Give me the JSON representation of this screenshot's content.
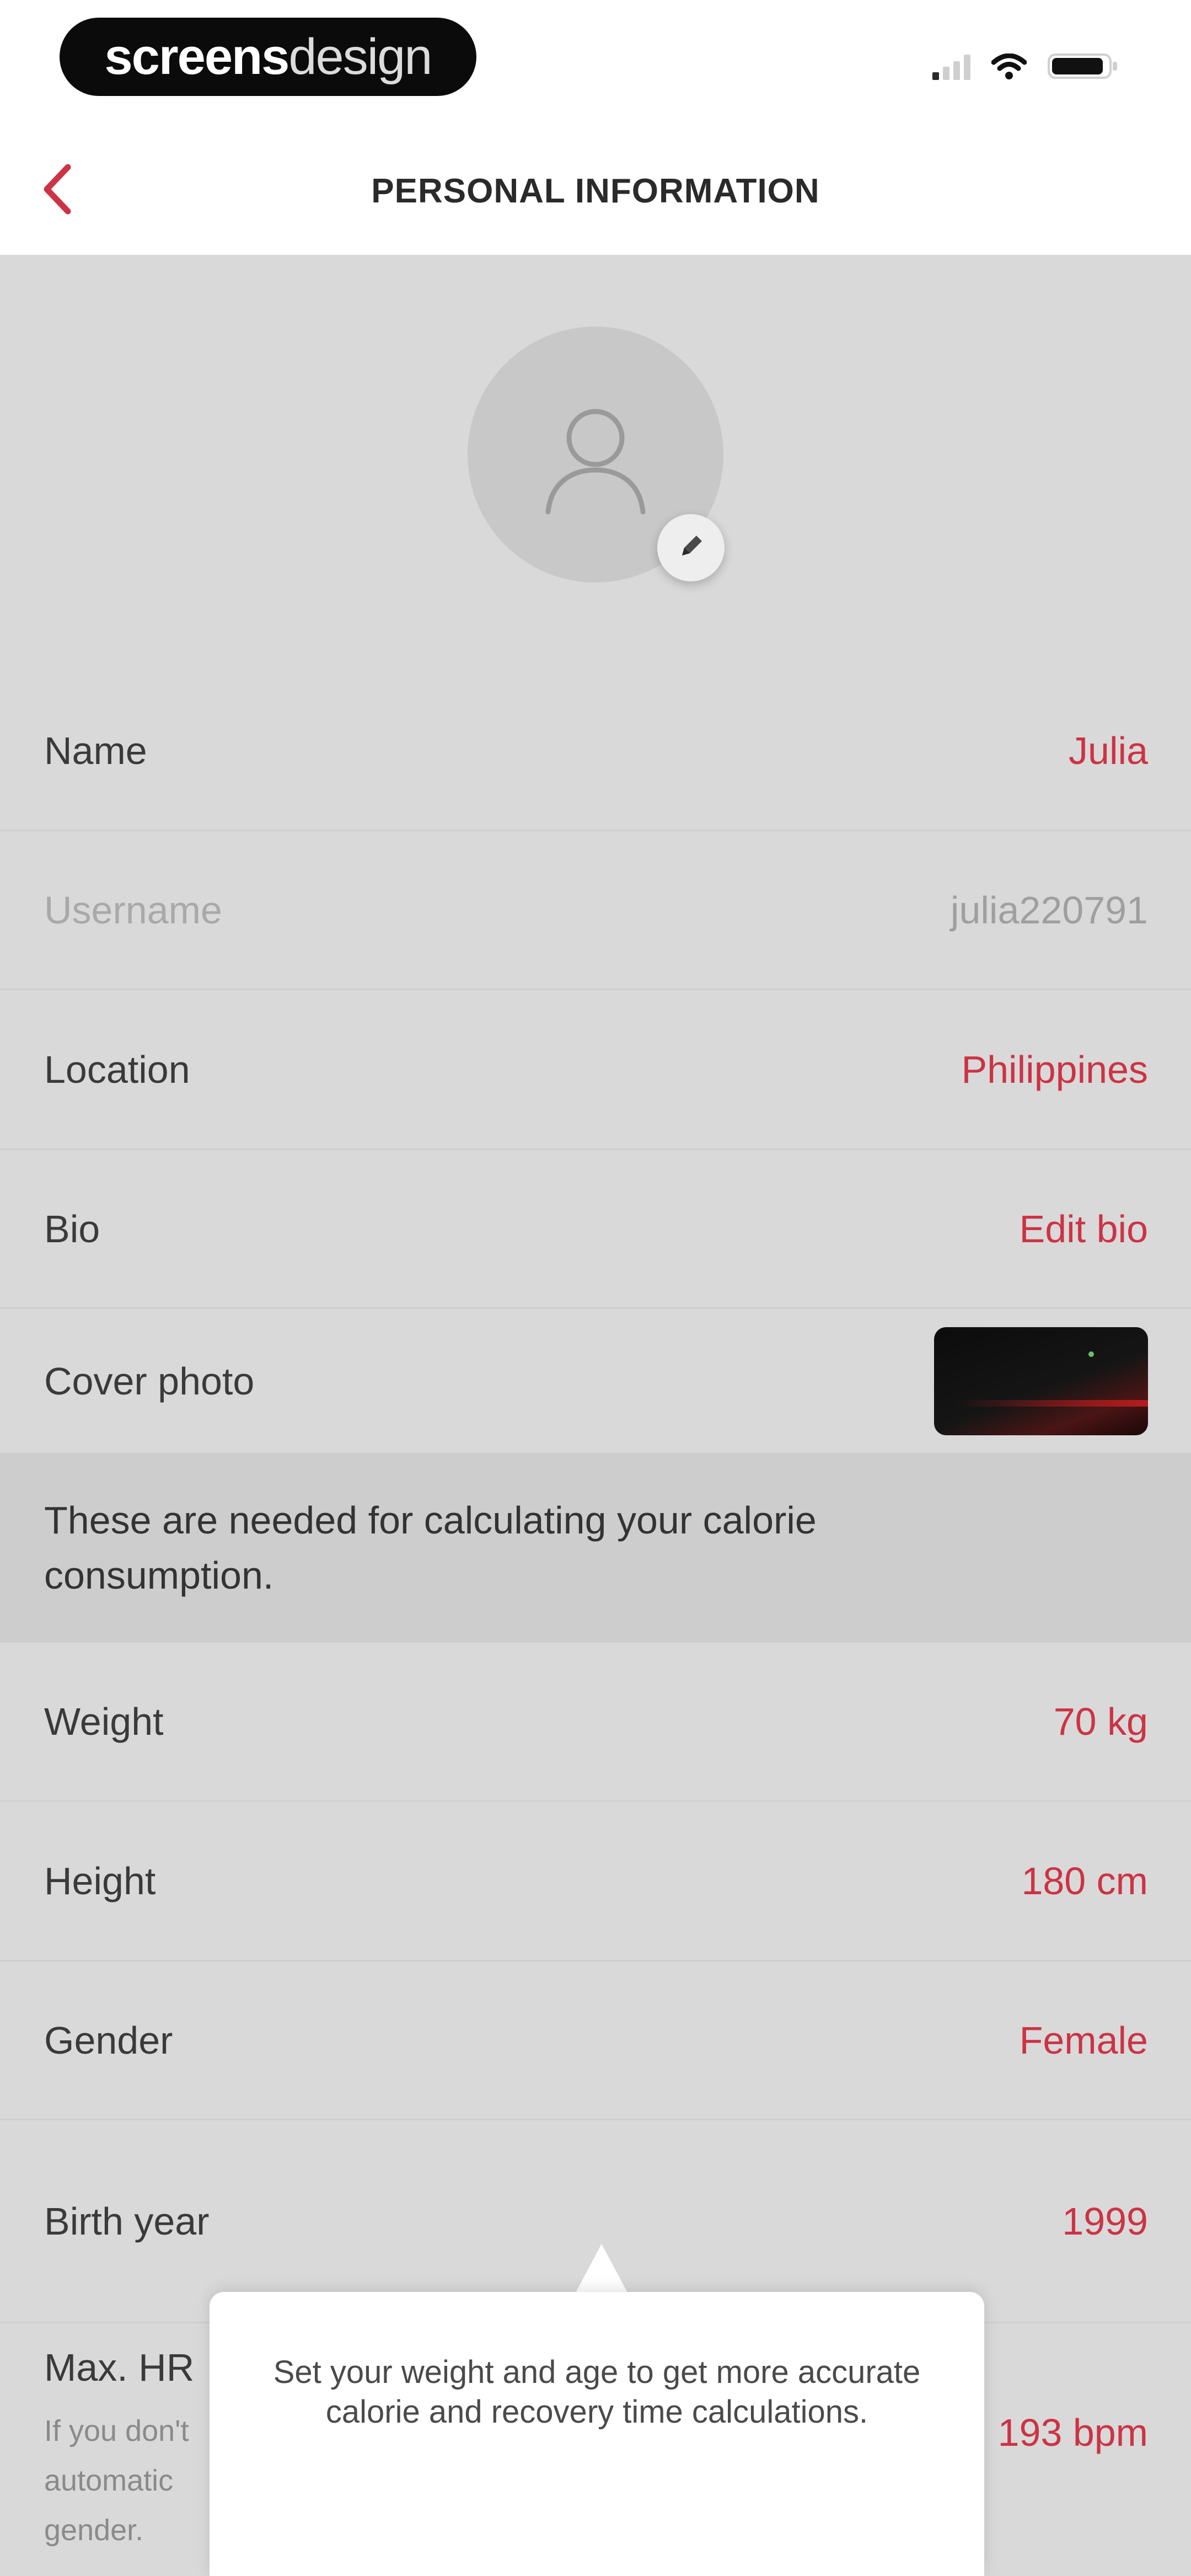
{
  "status_bar": {
    "brand_bold": "screens",
    "brand_light": "design"
  },
  "nav": {
    "title": "PERSONAL INFORMATION"
  },
  "profile": {
    "rows": [
      {
        "label": "Name",
        "value": "Julia"
      },
      {
        "label": "Username",
        "value": "julia220791"
      },
      {
        "label": "Location",
        "value": "Philippines"
      },
      {
        "label": "Bio",
        "value": "Edit bio"
      },
      {
        "label": "Cover photo"
      }
    ]
  },
  "calorie_note": "These are needed for calculating your calorie consumption.",
  "body_metrics": {
    "rows": [
      {
        "label": "Weight",
        "value": "70 kg"
      },
      {
        "label": "Height",
        "value": "180 cm"
      },
      {
        "label": "Gender",
        "value": "Female"
      },
      {
        "label": "Birth year",
        "value": "1999"
      }
    ]
  },
  "max_hr": {
    "label": "Max. HR",
    "sublines": [
      "If you don't",
      "automatic",
      "gender."
    ],
    "value": "193 bpm"
  },
  "tooltip": {
    "text": "Set your weight and age to get more accurate calorie and recovery time calculations."
  },
  "colors": {
    "accent": "#cc3344",
    "panel_bg": "#d9d9d9",
    "info_band_bg": "#cdcdcd"
  },
  "icons": {
    "back": "chevron-left-icon",
    "avatar": "person-icon",
    "edit": "pencil-icon"
  }
}
